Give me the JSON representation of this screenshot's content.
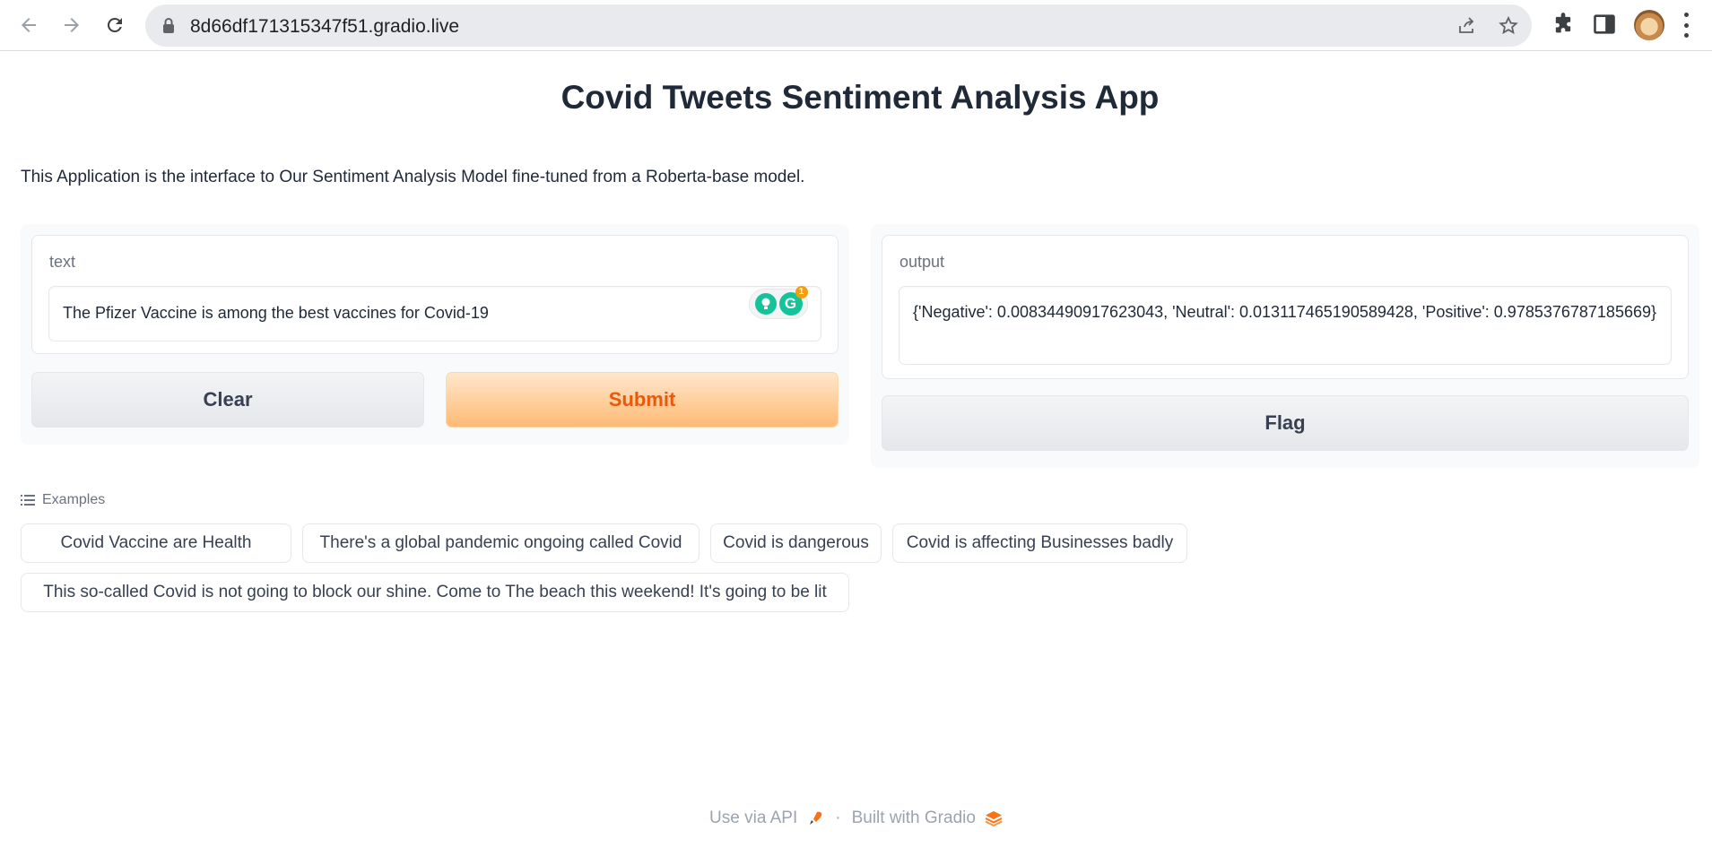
{
  "browser": {
    "url": "8d66df171315347f51.gradio.live"
  },
  "app": {
    "title": "Covid Tweets Sentiment Analysis App",
    "description": "This Application is the interface to Our Sentiment Analysis Model fine-tuned from a Roberta-base model."
  },
  "input": {
    "label": "text",
    "value": "The Pfizer Vaccine is among the best vaccines for Covid-19",
    "grammarly_badge_count": "1"
  },
  "buttons": {
    "clear": "Clear",
    "submit": "Submit",
    "flag": "Flag"
  },
  "output": {
    "label": "output",
    "value": "{'Negative': 0.00834490917623043, 'Neutral': 0.013117465190589428, 'Positive': 0.9785376787185669}"
  },
  "examples": {
    "heading": "Examples",
    "items": [
      "Covid Vaccine are Health",
      "There's a global pandemic ongoing called Covid",
      "Covid is dangerous",
      "Covid is affecting Businesses badly",
      "This so-called Covid is not going to block our shine. Come to The beach this weekend! It's going to be lit"
    ]
  },
  "footer": {
    "api_link": "Use via API",
    "separator": "·",
    "built_with": "Built with Gradio"
  },
  "colors": {
    "primary_text": "#ea580c",
    "primary_bg": "#fdba74",
    "accent_grammarly": "#15c39a"
  }
}
